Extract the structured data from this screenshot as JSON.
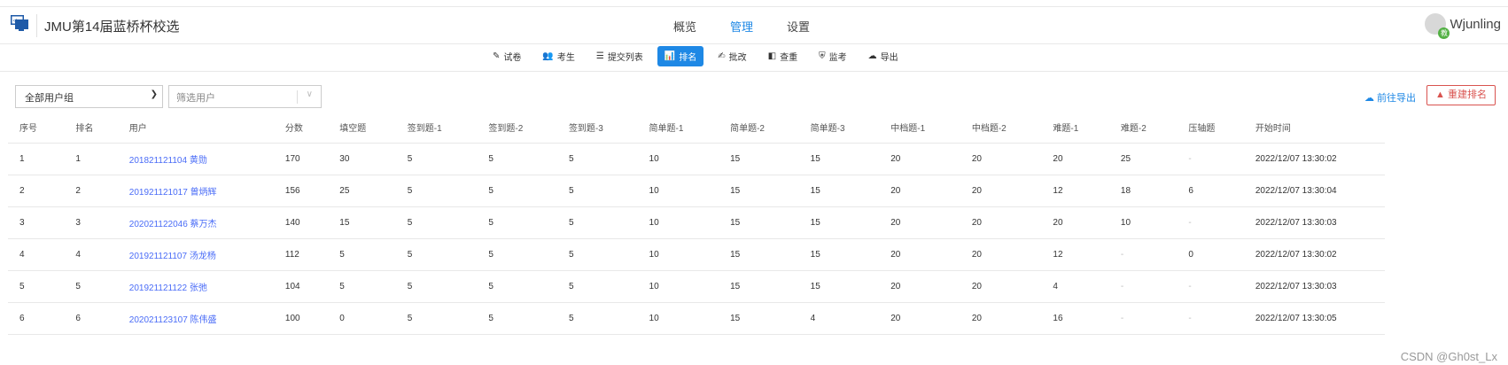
{
  "header": {
    "title": "JMU第14届蓝桥杯校选",
    "nav": [
      "概览",
      "管理",
      "设置"
    ],
    "active_nav": 1,
    "user": {
      "name": "Wjunling",
      "badge": "教"
    }
  },
  "subnav": [
    {
      "label": "试卷",
      "icon": "✎"
    },
    {
      "label": "考生",
      "icon": "👥"
    },
    {
      "label": "提交列表",
      "icon": "☰"
    },
    {
      "label": "排名",
      "icon": "📊"
    },
    {
      "label": "批改",
      "icon": "✍"
    },
    {
      "label": "查重",
      "icon": "◧"
    },
    {
      "label": "监考",
      "icon": "⛨"
    },
    {
      "label": "导出",
      "icon": "☁"
    }
  ],
  "active_subnav": 3,
  "toolbar": {
    "group_select": "全部用户组",
    "filter_placeholder": "筛选用户",
    "export_label": "前往导出",
    "rebuild_label": "重建排名"
  },
  "table": {
    "columns": [
      "序号",
      "排名",
      "用户",
      "分数",
      "填空题",
      "签到题-1",
      "签到题-2",
      "签到题-3",
      "简单题-1",
      "简单题-2",
      "简单题-3",
      "中档题-1",
      "中档题-2",
      "难题-1",
      "难题-2",
      "压轴题",
      "开始时间"
    ],
    "rows": [
      [
        "1",
        "1",
        "201821121104 黄勋",
        "170",
        "30",
        "5",
        "5",
        "5",
        "10",
        "15",
        "15",
        "20",
        "20",
        "20",
        "25",
        "-",
        "2022/12/07 13:30:02"
      ],
      [
        "2",
        "2",
        "201921121017 曾炳辉",
        "156",
        "25",
        "5",
        "5",
        "5",
        "10",
        "15",
        "15",
        "20",
        "20",
        "12",
        "18",
        "6",
        "2022/12/07 13:30:04"
      ],
      [
        "3",
        "3",
        "202021122046 蔡万杰",
        "140",
        "15",
        "5",
        "5",
        "5",
        "10",
        "15",
        "15",
        "20",
        "20",
        "20",
        "10",
        "-",
        "2022/12/07 13:30:03"
      ],
      [
        "4",
        "4",
        "201921121107 汤龙杨",
        "112",
        "5",
        "5",
        "5",
        "5",
        "10",
        "15",
        "15",
        "20",
        "20",
        "12",
        "-",
        "0",
        "2022/12/07 13:30:02"
      ],
      [
        "5",
        "5",
        "201921121122 张弛",
        "104",
        "5",
        "5",
        "5",
        "5",
        "10",
        "15",
        "15",
        "20",
        "20",
        "4",
        "-",
        "-",
        "2022/12/07 13:30:03"
      ],
      [
        "6",
        "6",
        "202021123107 陈伟盛",
        "100",
        "0",
        "5",
        "5",
        "5",
        "10",
        "15",
        "4",
        "20",
        "20",
        "16",
        "-",
        "-",
        "2022/12/07 13:30:05"
      ]
    ]
  },
  "watermark": "CSDN @Gh0st_Lx"
}
